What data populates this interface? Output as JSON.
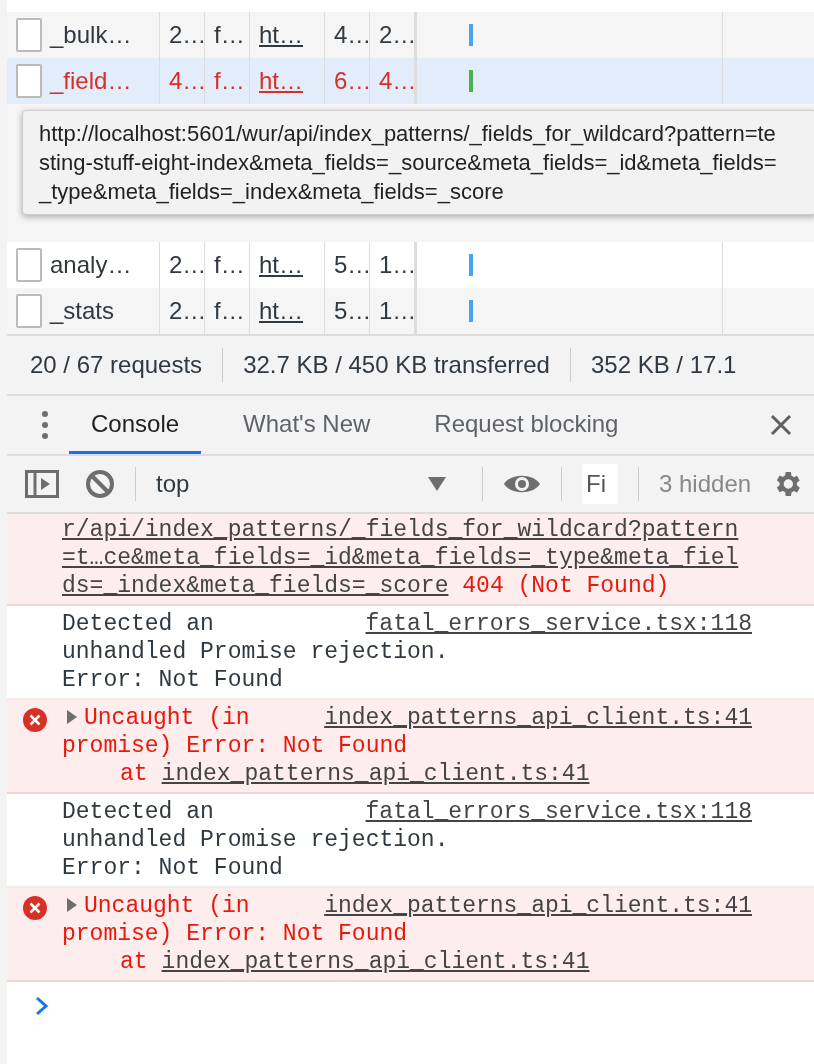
{
  "network_table": {
    "rows": [
      {
        "cells": [
          "_bulk…",
          "2…",
          "f…",
          "ht…",
          "4…",
          "2…"
        ],
        "error": false,
        "selected": false
      },
      {
        "cells": [
          "_field…",
          "4…",
          "f…",
          "ht…",
          "6…",
          "4…"
        ],
        "error": true,
        "selected": true
      },
      {
        "cells": [
          "analy…",
          "2…",
          "f…",
          "ht…",
          "5…",
          "1…"
        ],
        "error": false,
        "selected": false
      },
      {
        "cells": [
          "_stats",
          "2…",
          "f…",
          "ht…",
          "5…",
          "1…"
        ],
        "error": false,
        "selected": false
      }
    ],
    "tooltip": "http://localhost:5601/wur/api/index_patterns/_fields_for_wildcard?pattern=testing-stuff-eight-index&meta_fields=_source&meta_fields=_id&meta_fields=_type&meta_fields=_index&meta_fields=_score"
  },
  "status_bar": [
    "20 / 67 requests",
    "32.7 KB / 450 KB transferred",
    "352 KB / 17.1"
  ],
  "drawer_tabs": [
    {
      "label": "Console",
      "selected": true
    },
    {
      "label": "What's New",
      "selected": false
    },
    {
      "label": "Request blocking",
      "selected": false
    }
  ],
  "console_toolbar": {
    "context": "top",
    "filter_placeholder": "Fi",
    "hidden_count": "3 hidden"
  },
  "messages": [
    {
      "kind": "network_error",
      "url": "r/api/index_patterns/_fields_for_wildcard?pattern=t…ce&meta_fields=_id&meta_fields=_type&meta_fields=_index&meta_fields=_score",
      "status": "404 (Not Found)"
    },
    {
      "kind": "info",
      "lines": [
        "Detected an",
        "unhandled Promise rejection.",
        "Error: Not Found"
      ],
      "source": "fatal_errors_service.tsx:118"
    },
    {
      "kind": "error",
      "lines": [
        "Uncaught (in",
        "promise) Error: Not Found"
      ],
      "source": "index_patterns_api_client.ts:41",
      "stack_prefix": "at",
      "stack_link": "index_patterns_api_client.ts:41"
    },
    {
      "kind": "info",
      "lines": [
        "Detected an",
        "unhandled Promise rejection.",
        "Error: Not Found"
      ],
      "source": "fatal_errors_service.tsx:118"
    },
    {
      "kind": "error",
      "lines": [
        "Uncaught (in",
        "promise) Error: Not Found"
      ],
      "source": "index_patterns_api_client.ts:41",
      "stack_prefix": "at",
      "stack_link": "index_patterns_api_client.ts:41"
    }
  ]
}
